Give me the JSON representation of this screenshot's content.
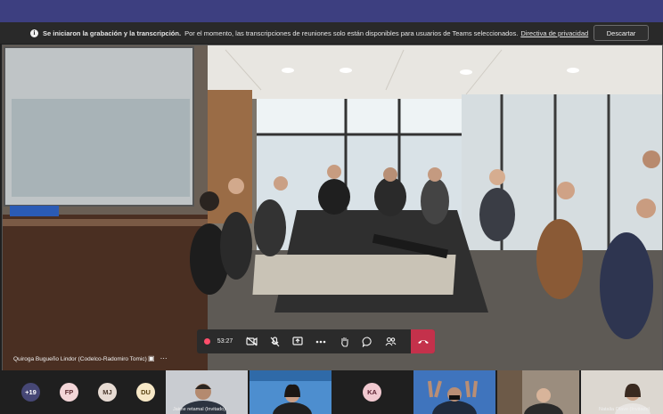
{
  "banner": {
    "bold_text": "Se iniciaron la grabación y la transcripción.",
    "message": "Por el momento, las transcripciones de reuniones solo están disponibles para usuarios de Teams seleccionados.",
    "link_text": "Directiva de privacidad",
    "dismiss_label": "Descartar"
  },
  "main_video": {
    "participant_name": "Quiroga Bugueño Lindor (Codelco-Radomiro Tomic)"
  },
  "call_controls": {
    "timer": "53:27",
    "recording_color": "#ff4e6b",
    "hangup_color": "#c4314b"
  },
  "participants": {
    "overflow_count": "+19",
    "initials": [
      "FP",
      "MJ",
      "DU",
      "KA"
    ],
    "tiles": [
      {
        "name": "Jaime retamal (Invitado)"
      },
      {
        "name": "Natalia Olave (Invitado)"
      }
    ]
  },
  "colors": {
    "topbar": "#3d3f80",
    "banner": "#292929",
    "accent_purple": "#464775"
  }
}
